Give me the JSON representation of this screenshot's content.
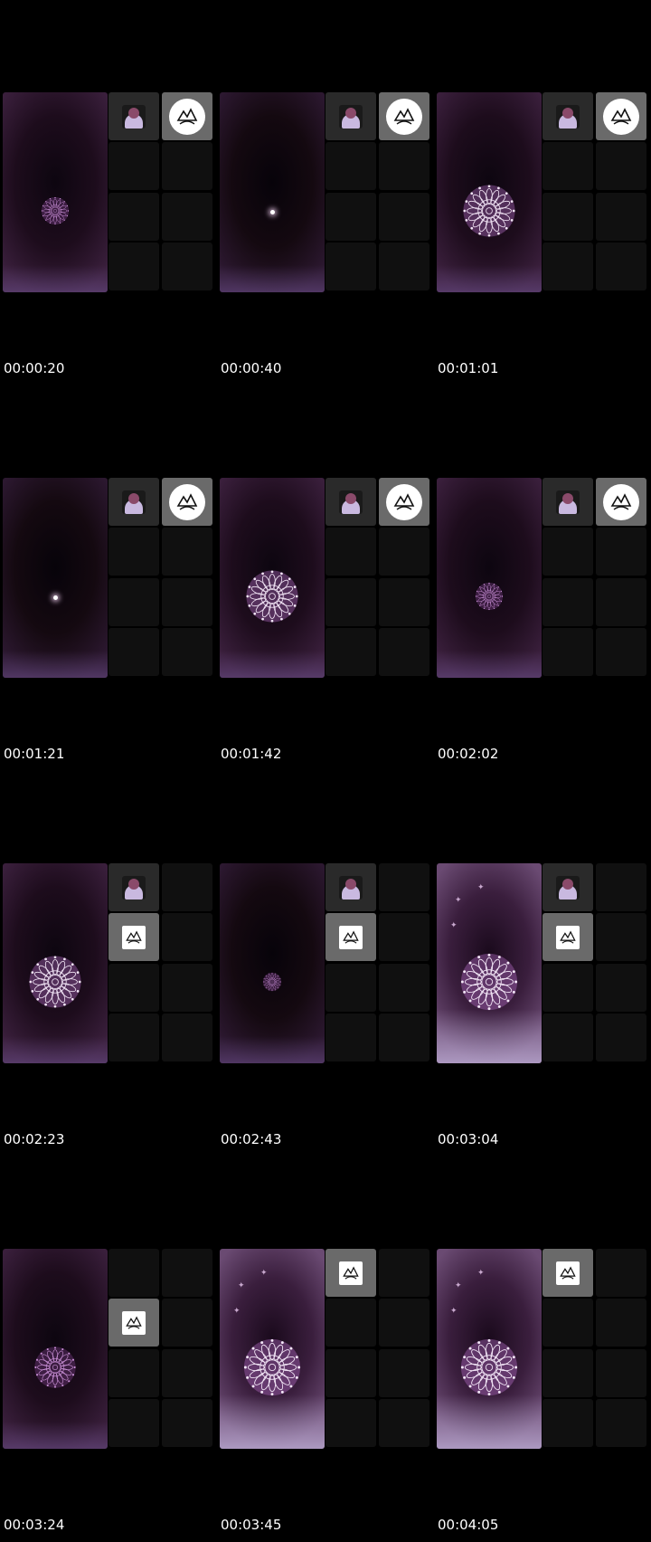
{
  "frames": [
    {
      "timestamp": "00:00:20",
      "scene": "small-mandala",
      "avatar": "top",
      "logo": "circle"
    },
    {
      "timestamp": "00:00:40",
      "scene": "dot",
      "avatar": "top",
      "logo": "circle"
    },
    {
      "timestamp": "00:01:01",
      "scene": "large-mandala",
      "avatar": "top",
      "logo": "circle"
    },
    {
      "timestamp": "00:01:21",
      "scene": "dot",
      "avatar": "top",
      "logo": "circle"
    },
    {
      "timestamp": "00:01:42",
      "scene": "large-mandala",
      "avatar": "top",
      "logo": "circle"
    },
    {
      "timestamp": "00:02:02",
      "scene": "small-mandala",
      "avatar": "top",
      "logo": "circle"
    },
    {
      "timestamp": "00:02:23",
      "scene": "large-mandala",
      "avatar": "top",
      "logo": "square-left"
    },
    {
      "timestamp": "00:02:43",
      "scene": "tiny-mandala",
      "avatar": "top",
      "logo": "square-left"
    },
    {
      "timestamp": "00:03:04",
      "scene": "large-mandala-bright",
      "avatar": "top",
      "logo": "square-left"
    },
    {
      "timestamp": "00:03:24",
      "scene": "medium-mandala",
      "avatar": "none",
      "logo": "square-left"
    },
    {
      "timestamp": "00:03:45",
      "scene": "large-mandala-bright",
      "avatar": "none",
      "logo": "square-top"
    },
    {
      "timestamp": "00:04:05",
      "scene": "large-mandala-bright",
      "avatar": "none",
      "logo": "square-top"
    }
  ],
  "icons": {
    "avatar": "user-avatar-icon",
    "logo": "brand-logo-icon",
    "mandala": "mandala-graphic"
  },
  "colors": {
    "background": "#000000",
    "accent": "#c98fd6",
    "cell": "#101010",
    "active_cell": "#6a6a6a"
  }
}
